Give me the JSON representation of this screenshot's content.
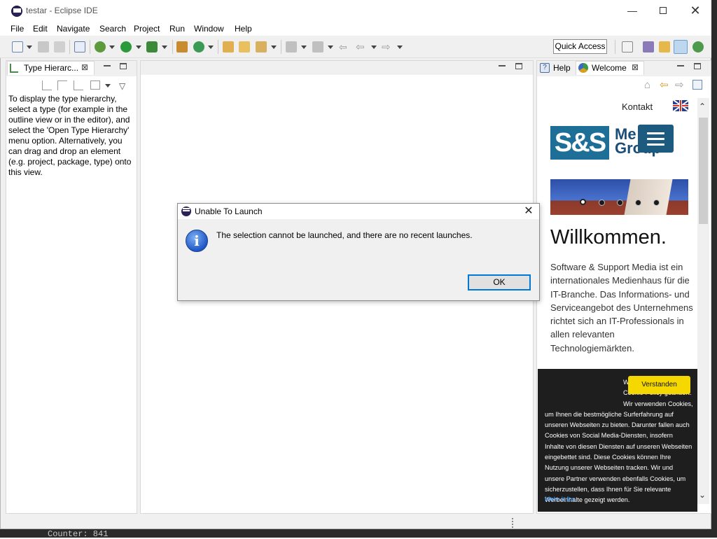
{
  "window": {
    "title": "testar - Eclipse IDE"
  },
  "menubar": {
    "items": [
      "File",
      "Edit",
      "Navigate",
      "Search",
      "Project",
      "Run",
      "Window",
      "Help"
    ]
  },
  "toolbar": {
    "quick_access": "Quick Access"
  },
  "left_panel": {
    "tab_label": "Type Hierarc...",
    "description": "To display the type hierarchy, select a type (for example in the outline view or in the editor), and select the 'Open Type Hierarchy' menu option. Alternatively, you can drag and drop an element (e.g. project, package, type) onto this view."
  },
  "right_panel": {
    "tabs": [
      "Help",
      "Welcome"
    ],
    "welcome": {
      "kontakt": "Kontakt",
      "logo_mark": "S&S",
      "logo_line1": "Me",
      "logo_line2": "Group",
      "heading": "Willkommen.",
      "body": "Software & Support Media ist ein internationales Medienhaus für die IT-Branche. Das Informations- und Serviceangebot des Unternehmens richtet sich an IT-Professionals in allen relevanten Technologiemärkten."
    },
    "cookie": {
      "text": "Wir haben unsere Cookie-Policy geändert. Wir verwenden Cookies, um Ihnen die bestmögliche Surferfahrung auf unseren Webseiten zu bieten. Darunter fallen auch Cookies von Social Media-Diensten, insofern Inhalte von diesen Diensten auf unseren Webseiten eingebettet sind. Diese Cookies können Ihre Nutzung unserer Webseiten tracken. Wir und unsere Partner verwenden ebenfalls Cookies, um sicherzustellen, dass Ihnen für Sie relevante Werbeinhalte gezeigt werden.",
      "accept_button": "Verstanden",
      "more_link": "Mehr Infos"
    }
  },
  "dialog": {
    "title": "Unable To Launch",
    "message": "The selection cannot be launched, and there are no recent launches.",
    "ok_button": "OK"
  },
  "background_console": {
    "text": "Counter: 841"
  },
  "colors": {
    "accent": "#0078d7",
    "brand": "#1d6f98",
    "cookie_button": "#f5d800",
    "link": "#3ca0ff"
  }
}
